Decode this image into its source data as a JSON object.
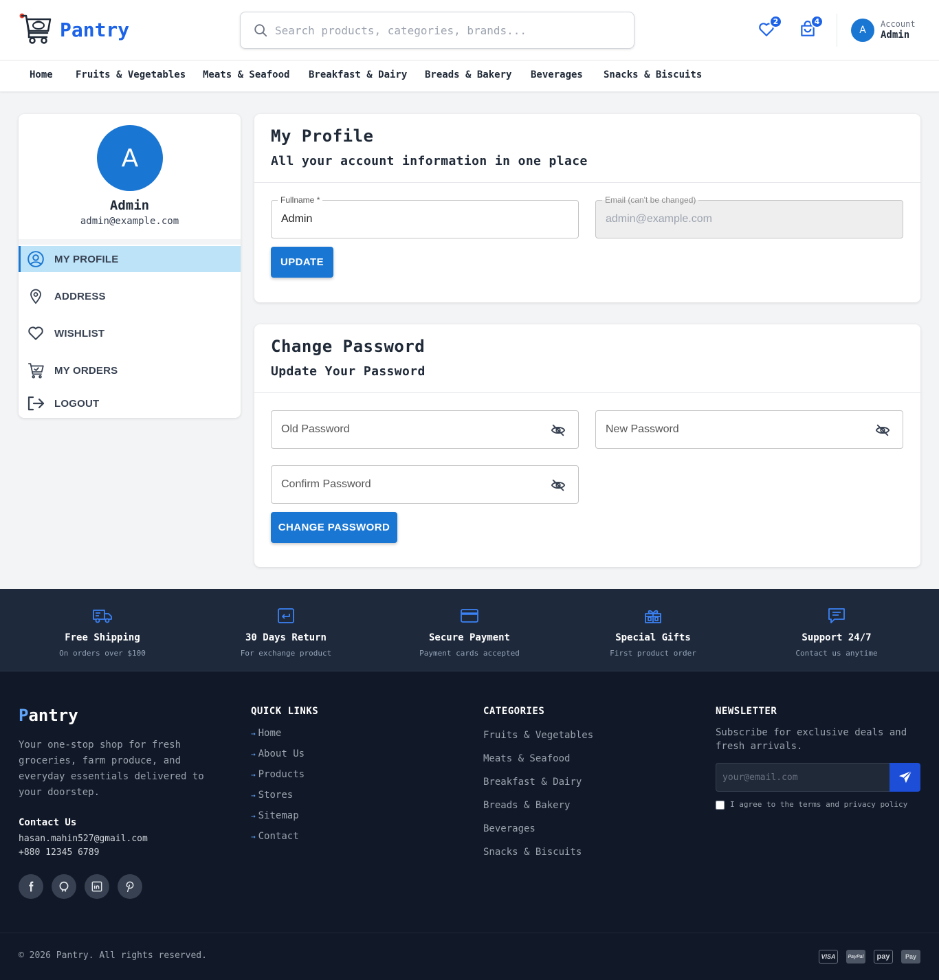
{
  "brand": {
    "name": "Pantry"
  },
  "search": {
    "placeholder": "Search products, categories, brands..."
  },
  "header": {
    "wishlist_count": "2",
    "cart_count": "4",
    "account_label": "Account",
    "account_name": "Admin",
    "avatar_letter": "A"
  },
  "nav": {
    "items": [
      "Home",
      "Fruits & Vegetables",
      "Meats & Seafood",
      "Breakfast & Dairy",
      "Breads & Bakery",
      "Beverages",
      "Snacks & Biscuits"
    ]
  },
  "sidebar": {
    "avatar_letter": "A",
    "name": "Admin",
    "email": "admin@example.com",
    "menu": [
      {
        "label": "MY PROFILE",
        "icon": "user-circle-icon",
        "active": true
      },
      {
        "label": "ADDRESS",
        "icon": "map-pin-icon"
      },
      {
        "label": "WISHLIST",
        "icon": "heart-icon"
      },
      {
        "label": "MY ORDERS",
        "icon": "cart-check-icon"
      },
      {
        "label": "LOGOUT",
        "icon": "logout-icon"
      }
    ]
  },
  "profile": {
    "title": "My Profile",
    "subtitle": "All your account information in one place",
    "fullname_label": "Fullname *",
    "fullname_value": "Admin",
    "email_label": "Email (can't be changed)",
    "email_value": "admin@example.com",
    "update_button": "UPDATE"
  },
  "password": {
    "title": "Change Password",
    "subtitle": "Update Your Password",
    "old_placeholder": "Old Password",
    "new_placeholder": "New Password",
    "confirm_placeholder": "Confirm Password",
    "button": "CHANGE PASSWORD"
  },
  "features": [
    {
      "title": "Free Shipping",
      "sub": "On orders over $100",
      "icon": "truck-icon"
    },
    {
      "title": "30 Days Return",
      "sub": "For exchange product",
      "icon": "return-icon"
    },
    {
      "title": "Secure Payment",
      "sub": "Payment cards accepted",
      "icon": "credit-card-icon"
    },
    {
      "title": "Special Gifts",
      "sub": "First product order",
      "icon": "gift-icon"
    },
    {
      "title": "Support 24/7",
      "sub": "Contact us anytime",
      "icon": "chat-icon"
    }
  ],
  "footer": {
    "logo_first": "P",
    "logo_rest": "antry",
    "description": "Your one-stop shop for fresh groceries, farm produce, and everyday essentials delivered to your doorstep.",
    "contact_heading": "Contact Us",
    "contact_email": "hasan.mahin527@gmail.com",
    "contact_phone": "+880 12345 6789",
    "social": [
      "facebook-icon",
      "github-icon",
      "linkedin-icon",
      "pinterest-icon"
    ],
    "quick_links_heading": "QUICK LINKS",
    "quick_links": [
      "Home",
      "About Us",
      "Products",
      "Stores",
      "Sitemap",
      "Contact"
    ],
    "categories_heading": "CATEGORIES",
    "categories": [
      "Fruits & Vegetables",
      "Meats & Seafood",
      "Breakfast & Dairy",
      "Breads & Bakery",
      "Beverages",
      "Snacks & Biscuits"
    ],
    "newsletter_heading": "NEWSLETTER",
    "newsletter_desc": "Subscribe for exclusive deals and fresh arrivals.",
    "newsletter_placeholder": "your@email.com",
    "newsletter_agree": "I agree to the terms and privacy policy",
    "copyright": "© 2026 Pantry. All rights reserved.",
    "payments": [
      "VISA",
      "PayPal",
      "pay",
      "Pay"
    ]
  },
  "colors": {
    "brand": "#1d63e8",
    "primary_button": "#1976d2",
    "active_menu_bg": "#bde3f9",
    "features_bg": "#1e293b",
    "footer_bg": "#111827"
  }
}
